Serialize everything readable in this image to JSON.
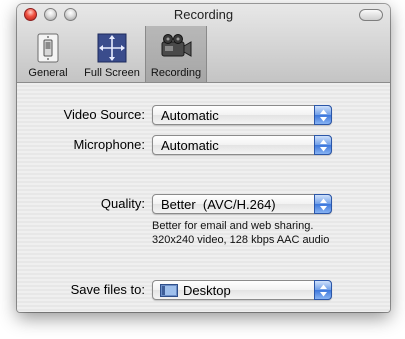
{
  "window": {
    "title": "Recording"
  },
  "tabs": [
    {
      "label": "General",
      "icon": "light-switch-icon",
      "selected": false
    },
    {
      "label": "Full Screen",
      "icon": "fullscreen-arrows-icon",
      "selected": false
    },
    {
      "label": "Recording",
      "icon": "video-camera-icon",
      "selected": true
    }
  ],
  "settings": {
    "video_source": {
      "label": "Video Source:",
      "value": "Automatic"
    },
    "microphone": {
      "label": "Microphone:",
      "value": "Automatic"
    },
    "quality": {
      "label": "Quality:",
      "value": "Better  (AVC/H.264)",
      "description_line1": "Better for email and web sharing.",
      "description_line2": "320x240 video, 128 kbps AAC audio"
    },
    "save_files": {
      "label": "Save files to:",
      "value": "Desktop"
    }
  },
  "colors": {
    "accent": "#3d77dc",
    "close_button": "#f05040"
  }
}
